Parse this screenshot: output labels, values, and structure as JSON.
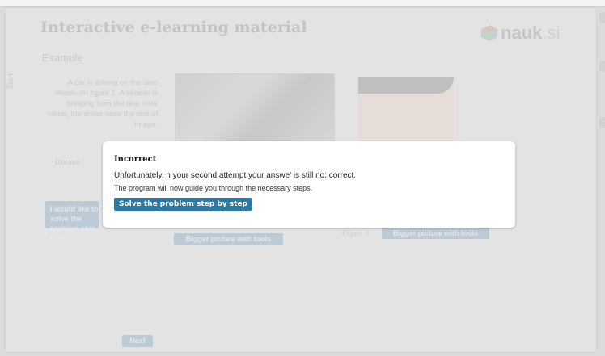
{
  "header": {
    "title": "Interactive e-learning material",
    "subtitle": "Example",
    "side_tab": "Štart",
    "logo_text": "nauk",
    "logo_domain": ".si"
  },
  "content": {
    "paragraph": "A car is driving on the lane shown on figure 1. A vehicle is bringing from the rear view mirror, the driver sees the rest of image.",
    "question_prefix": "Dbrave..",
    "step_button": "I would like to solve the problem step by step",
    "figure_label": "Figure 2",
    "bigger_picture_1": "Bigger picture with tools",
    "bigger_picture_2": "Bigger picture with tools",
    "next_button": "Next"
  },
  "modal": {
    "title": "Incorrect",
    "line1": "Unfortunately, n your second attempt your answe' is still no: correct.",
    "line2": "The program will now guide you through the necessary steps.",
    "button": "Solve the problem step by step"
  },
  "colors": {
    "accent": "#2a79a6",
    "overlay_bg": "#e3e3e3"
  }
}
